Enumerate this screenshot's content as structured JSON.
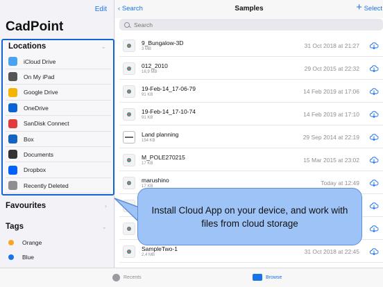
{
  "sidebar": {
    "edit_label": "Edit",
    "app_title": "CadPoint",
    "locations_title": "Locations",
    "locations": [
      {
        "label": "iCloud Drive",
        "icon": "icloud-icon",
        "color": "#4aa3f0"
      },
      {
        "label": "On My iPad",
        "icon": "ipad-icon",
        "color": "#555555"
      },
      {
        "label": "Google Drive",
        "icon": "google-drive-icon",
        "color": "#f4b400"
      },
      {
        "label": "OneDrive",
        "icon": "onedrive-icon",
        "color": "#0a64d4"
      },
      {
        "label": "SanDisk Connect",
        "icon": "sandisk-icon",
        "color": "#e23b3b"
      },
      {
        "label": "Box",
        "icon": "box-icon",
        "color": "#1464c4"
      },
      {
        "label": "Documents",
        "icon": "documents-icon",
        "color": "#333333"
      },
      {
        "label": "Dropbox",
        "icon": "dropbox-icon",
        "color": "#0061fe"
      },
      {
        "label": "Recently Deleted",
        "icon": "trash-icon",
        "color": "#8e8e93"
      }
    ],
    "favourites_title": "Favourites",
    "tags_title": "Tags",
    "tags": [
      {
        "label": "Orange",
        "color": "#f5a623"
      },
      {
        "label": "Blue",
        "color": "#1a73e8"
      }
    ]
  },
  "main": {
    "back_label": "Search",
    "title": "Samples",
    "plus_label": "+",
    "select_label": "Select",
    "search_placeholder": "Search",
    "files": [
      {
        "name": "9_Bungalow-3D",
        "size": "3 MB",
        "date": "31 Oct 2018 at 21:27",
        "thumb": "model"
      },
      {
        "name": "012_2010",
        "size": "16,9 MB",
        "date": "29 Oct 2015 at 22:32",
        "thumb": "model"
      },
      {
        "name": "19-Feb-14_17-06-79",
        "size": "91 KB",
        "date": "14 Feb 2019 at 17:06",
        "thumb": "model"
      },
      {
        "name": "19-Feb-14_17-10-74",
        "size": "91 KB",
        "date": "14 Feb 2019 at 17:10",
        "thumb": "model"
      },
      {
        "name": "Land planning",
        "size": "154 KB",
        "date": "29 Sep 2014 at 22:19",
        "thumb": "plan"
      },
      {
        "name": "M_POLE270215",
        "size": "17 KB",
        "date": "15 Mar 2015 at 23:02",
        "thumb": "model"
      },
      {
        "name": "marushino",
        "size": "17 KB",
        "date": "Today at 12:49",
        "thumb": "model"
      },
      {
        "name": "",
        "size": "",
        "date": "",
        "thumb": "model"
      },
      {
        "name": "",
        "size": "",
        "date": "",
        "thumb": "model"
      },
      {
        "name": "SampleTwo-1",
        "size": "2,4 MB",
        "date": "31 Oct 2018 at 22:45",
        "thumb": "model"
      }
    ]
  },
  "callout": {
    "text": "Install Cloud App on your device, and work with files from cloud storage"
  },
  "tabbar": {
    "recents_label": "Recents",
    "browse_label": "Browse"
  },
  "colors": {
    "accent": "#1a73e8",
    "highlight_border": "#1263d6",
    "callout_fill": "#9ec3f7"
  }
}
